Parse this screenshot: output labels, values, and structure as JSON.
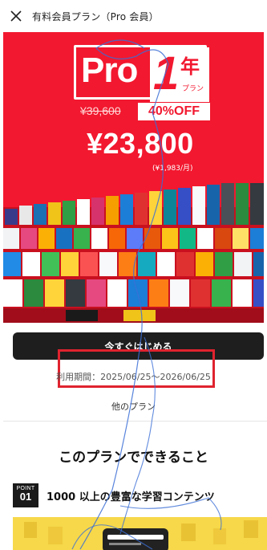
{
  "header": {
    "title": "有料会員プラン（Pro 会員）",
    "close_icon": "close-icon"
  },
  "hero": {
    "pro_label": "Pro",
    "duration_number": "1",
    "duration_unit": "年",
    "plan_word": "プラン",
    "original_price": "¥39,600",
    "discount": "40%OFF",
    "price": "¥23,800",
    "monthly": "(¥1,983/月)",
    "accent_color": "#f2182f"
  },
  "cta": {
    "label": "今すぐはじめる"
  },
  "period": "利用期間：2025/06/25〜2026/06/25",
  "other_plan": "他のプラン",
  "section": {
    "title": "このプランでできること"
  },
  "point": {
    "label": "POINT",
    "number": "01",
    "title": "1000 以上の豊富な学習コンテンツ"
  }
}
